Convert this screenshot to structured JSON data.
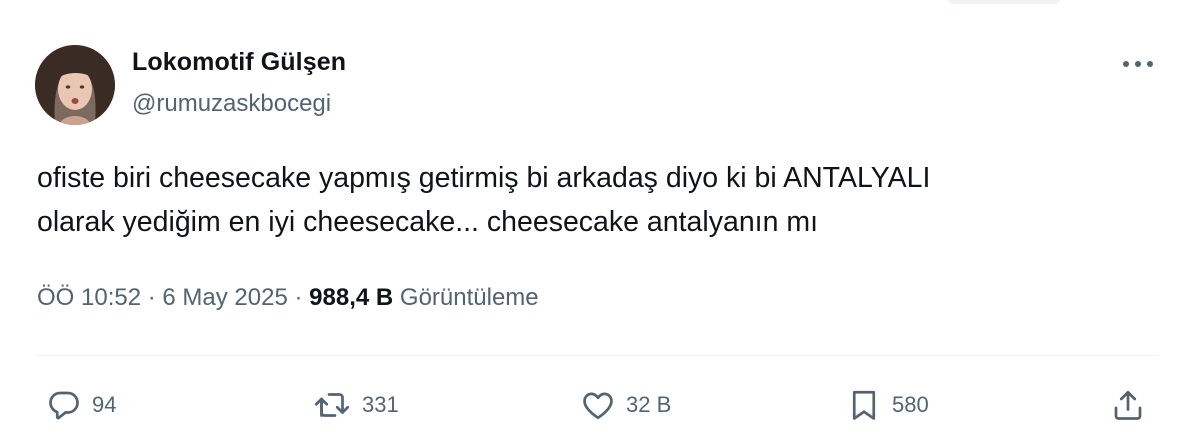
{
  "user": {
    "display_name": "Lokomotif Gülşen",
    "handle": "@rumuzaskbocegi"
  },
  "tweet": {
    "lines": [
      "ofiste biri cheesecake yapmış getirmiş bi arkadaş diyo ki bi ANTALYALI",
      "olarak yediğim en iyi cheesecake... cheesecake antalyanın mı"
    ]
  },
  "meta": {
    "time": "ÖÖ 10:52",
    "separator": "·",
    "date": "6 May 2025",
    "views_count": "988,4 B",
    "views_label": "Görüntüleme"
  },
  "actions": {
    "replies": "94",
    "retweets": "331",
    "likes": "32 B",
    "bookmarks": "580"
  },
  "icons": [
    "more-icon",
    "reply-icon",
    "retweet-icon",
    "like-icon",
    "bookmark-icon",
    "share-icon"
  ],
  "colors": {
    "primary_text": "#0f1419",
    "secondary_text": "#536471",
    "divider": "#eff3f4"
  }
}
